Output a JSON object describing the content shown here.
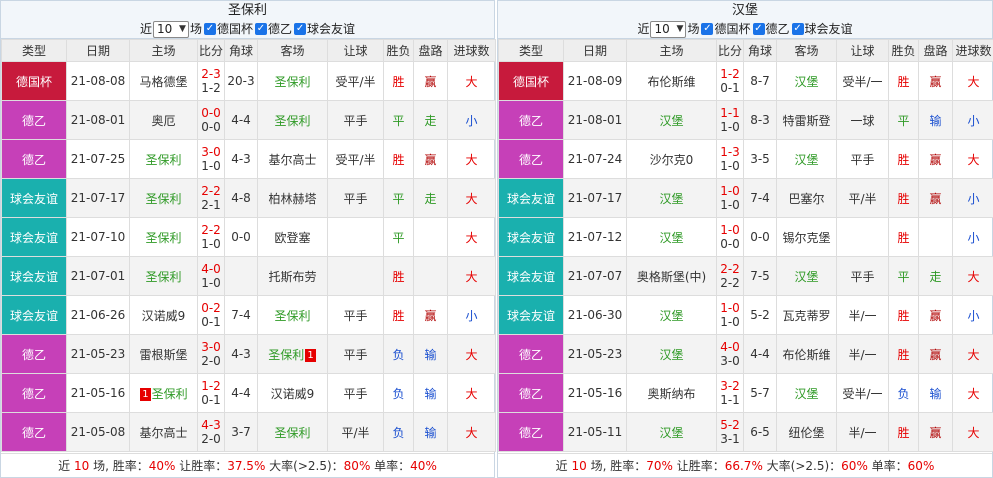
{
  "headers": [
    "类型",
    "日期",
    "主场",
    "比分",
    "角球",
    "客场",
    "让球",
    "胜负",
    "盘路",
    "进球数"
  ],
  "filter_labels": {
    "near": "近",
    "count": "10",
    "unit": "场",
    "cup": "德国杯",
    "league": "德乙",
    "friendly": "球会友谊"
  },
  "colors": {
    "cup": "#c71a3c",
    "league": "#c640b8",
    "friendly": "#1ab0ae",
    "win": "#e60000",
    "draw": "#2f9a26",
    "lose": "#1a4fd0"
  },
  "left": {
    "team": "圣保利",
    "rows": [
      {
        "type": "德国杯",
        "type_class": "cup",
        "date": "21-08-08",
        "home": "马格德堡",
        "home_card": "",
        "score": "2-3",
        "half": "1-2",
        "corner": "20-3",
        "away": "圣保利",
        "away_card": "",
        "handicap": "受平/半",
        "result": "胜",
        "pan": "赢",
        "goals": "大"
      },
      {
        "type": "德乙",
        "type_class": "league",
        "date": "21-08-01",
        "home": "奥厄",
        "home_card": "",
        "score": "0-0",
        "half": "0-0",
        "corner": "4-4",
        "away": "圣保利",
        "away_card": "",
        "handicap": "平手",
        "result": "平",
        "pan": "走",
        "goals": "小"
      },
      {
        "type": "德乙",
        "type_class": "league",
        "date": "21-07-25",
        "home": "圣保利",
        "home_card": "",
        "score": "3-0",
        "half": "1-0",
        "corner": "4-3",
        "away": "基尔高士",
        "away_card": "",
        "handicap": "受平/半",
        "result": "胜",
        "pan": "赢",
        "goals": "大"
      },
      {
        "type": "球会友谊",
        "type_class": "friendly",
        "date": "21-07-17",
        "home": "圣保利",
        "home_card": "",
        "score": "2-2",
        "half": "2-1",
        "corner": "4-8",
        "away": "柏林赫塔",
        "away_card": "",
        "handicap": "平手",
        "result": "平",
        "pan": "走",
        "goals": "大"
      },
      {
        "type": "球会友谊",
        "type_class": "friendly",
        "date": "21-07-10",
        "home": "圣保利",
        "home_card": "",
        "score": "2-2",
        "half": "1-0",
        "corner": "0-0",
        "away": "欧登塞",
        "away_card": "",
        "handicap": "",
        "result": "平",
        "pan": "",
        "goals": "大"
      },
      {
        "type": "球会友谊",
        "type_class": "friendly",
        "date": "21-07-01",
        "home": "圣保利",
        "home_card": "",
        "score": "4-0",
        "half": "1-0",
        "corner": "",
        "away": "托斯布劳",
        "away_card": "",
        "handicap": "",
        "result": "胜",
        "pan": "",
        "goals": "大"
      },
      {
        "type": "球会友谊",
        "type_class": "friendly",
        "date": "21-06-26",
        "home": "汉诺威9",
        "home_card": "",
        "score": "0-2",
        "half": "0-1",
        "corner": "7-4",
        "away": "圣保利",
        "away_card": "",
        "handicap": "平手",
        "result": "胜",
        "pan": "赢",
        "goals": "小"
      },
      {
        "type": "德乙",
        "type_class": "league",
        "date": "21-05-23",
        "home": "雷根斯堡",
        "home_card": "",
        "score": "3-0",
        "half": "2-0",
        "corner": "4-3",
        "away": "圣保利",
        "away_card": "1",
        "handicap": "平手",
        "result": "负",
        "pan": "输",
        "goals": "大"
      },
      {
        "type": "德乙",
        "type_class": "league",
        "date": "21-05-16",
        "home": "圣保利",
        "home_card": "1",
        "score": "1-2",
        "half": "0-1",
        "corner": "4-4",
        "away": "汉诺威9",
        "away_card": "",
        "handicap": "平手",
        "result": "负",
        "pan": "输",
        "goals": "大"
      },
      {
        "type": "德乙",
        "type_class": "league",
        "date": "21-05-08",
        "home": "基尔高士",
        "home_card": "",
        "score": "4-3",
        "half": "2-0",
        "corner": "3-7",
        "away": "圣保利",
        "away_card": "",
        "handicap": "平/半",
        "result": "负",
        "pan": "输",
        "goals": "大"
      }
    ],
    "summary": {
      "p1": "近 ",
      "games": "10",
      "p2": " 场, 胜率：",
      "win": "40%",
      "p3": " 让胜率：",
      "hwin": "37.5%",
      "p4": " 大率(>2.5)：",
      "big": "80%",
      "p5": " 单率：",
      "odd": "40%"
    }
  },
  "right": {
    "team": "汉堡",
    "rows": [
      {
        "type": "德国杯",
        "type_class": "cup",
        "date": "21-08-09",
        "home": "布伦斯维",
        "home_card": "",
        "score": "1-2",
        "half": "0-1",
        "corner": "8-7",
        "away": "汉堡",
        "away_card": "",
        "handicap": "受半/一",
        "result": "胜",
        "pan": "赢",
        "goals": "大"
      },
      {
        "type": "德乙",
        "type_class": "league",
        "date": "21-08-01",
        "home": "汉堡",
        "home_card": "",
        "score": "1-1",
        "half": "1-0",
        "corner": "8-3",
        "away": "特雷斯登",
        "away_card": "",
        "handicap": "一球",
        "result": "平",
        "pan": "输",
        "goals": "小"
      },
      {
        "type": "德乙",
        "type_class": "league",
        "date": "21-07-24",
        "home": "沙尔克0",
        "home_card": "",
        "score": "1-3",
        "half": "1-0",
        "corner": "3-5",
        "away": "汉堡",
        "away_card": "",
        "handicap": "平手",
        "result": "胜",
        "pan": "赢",
        "goals": "大"
      },
      {
        "type": "球会友谊",
        "type_class": "friendly",
        "date": "21-07-17",
        "home": "汉堡",
        "home_card": "",
        "score": "1-0",
        "half": "1-0",
        "corner": "7-4",
        "away": "巴塞尔",
        "away_card": "",
        "handicap": "平/半",
        "result": "胜",
        "pan": "赢",
        "goals": "小"
      },
      {
        "type": "球会友谊",
        "type_class": "friendly",
        "date": "21-07-12",
        "home": "汉堡",
        "home_card": "",
        "score": "1-0",
        "half": "0-0",
        "corner": "0-0",
        "away": "锡尔克堡",
        "away_card": "",
        "handicap": "",
        "result": "胜",
        "pan": "",
        "goals": "小"
      },
      {
        "type": "球会友谊",
        "type_class": "friendly",
        "date": "21-07-07",
        "home": "奥格斯堡(中)",
        "home_card": "",
        "score": "2-2",
        "half": "2-2",
        "corner": "7-5",
        "away": "汉堡",
        "away_card": "",
        "handicap": "平手",
        "result": "平",
        "pan": "走",
        "goals": "大"
      },
      {
        "type": "球会友谊",
        "type_class": "friendly",
        "date": "21-06-30",
        "home": "汉堡",
        "home_card": "",
        "score": "1-0",
        "half": "1-0",
        "corner": "5-2",
        "away": "瓦克蒂罗",
        "away_card": "",
        "handicap": "半/一",
        "result": "胜",
        "pan": "赢",
        "goals": "小"
      },
      {
        "type": "德乙",
        "type_class": "league",
        "date": "21-05-23",
        "home": "汉堡",
        "home_card": "",
        "score": "4-0",
        "half": "3-0",
        "corner": "4-4",
        "away": "布伦斯维",
        "away_card": "",
        "handicap": "半/一",
        "result": "胜",
        "pan": "赢",
        "goals": "大"
      },
      {
        "type": "德乙",
        "type_class": "league",
        "date": "21-05-16",
        "home": "奥斯纳布",
        "home_card": "",
        "score": "3-2",
        "half": "1-1",
        "corner": "5-7",
        "away": "汉堡",
        "away_card": "",
        "handicap": "受半/一",
        "result": "负",
        "pan": "输",
        "goals": "大"
      },
      {
        "type": "德乙",
        "type_class": "league",
        "date": "21-05-11",
        "home": "汉堡",
        "home_card": "",
        "score": "5-2",
        "half": "3-1",
        "corner": "6-5",
        "away": "纽伦堡",
        "away_card": "",
        "handicap": "半/一",
        "result": "胜",
        "pan": "赢",
        "goals": "大"
      }
    ],
    "summary": {
      "p1": "近 ",
      "games": "10",
      "p2": " 场, 胜率：",
      "win": "70%",
      "p3": " 让胜率：",
      "hwin": "66.7%",
      "p4": " 大率(>2.5)：",
      "big": "60%",
      "p5": " 单率：",
      "odd": "60%"
    }
  }
}
